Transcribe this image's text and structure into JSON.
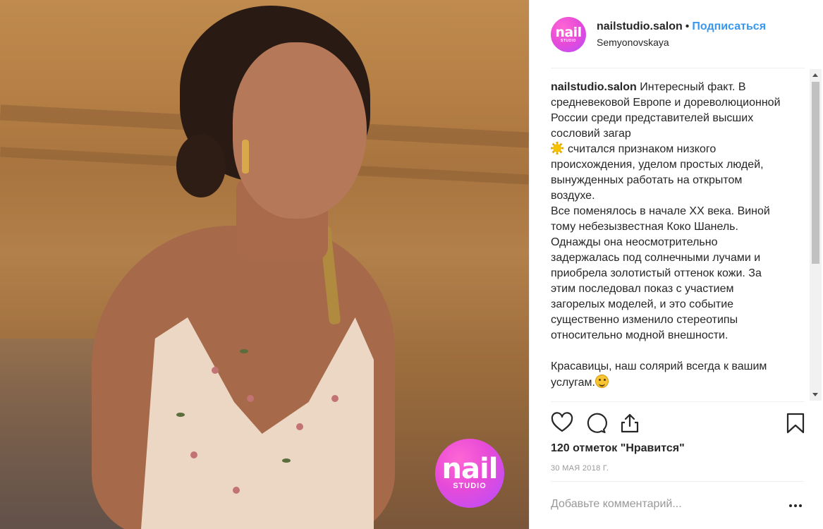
{
  "photo": {
    "logo_word": "nail",
    "logo_sub": "STUDIO"
  },
  "header": {
    "avatar_word": "nail",
    "avatar_sub": "STUDIO",
    "username": "nailstudio.salon",
    "separator": "•",
    "follow_label": "Подписаться",
    "location": "Semyonovskaya"
  },
  "caption": {
    "username": "nailstudio.salon",
    "line1": "Интересный факт. В средневековой Европе и дореволюционной России среди представителей высших сословий загар",
    "line2": "считался признаком низкого происхождения, уделом простых людей, вынужденных работать на открытом воздухе.",
    "line3": "Все поменялось в начале XX века. Виной тому небезызвестная Коко Шанель. Однажды она неосмотрительно задержалась под солнечными лучами и приобрела золотистый оттенок кожи. За этим последовал показ с участием загорелых моделей, и это событие существенно изменило стереотипы относительно модной внешности.",
    "line4": "Красавицы, наш солярий всегда к вашим услугам."
  },
  "actions": {
    "like_icon": "heart-icon",
    "comment_icon": "comment-icon",
    "share_icon": "share-icon",
    "save_icon": "bookmark-icon"
  },
  "likes_text": "120 отметок \"Нравится\"",
  "date_text": "30 МАЯ 2018 Г.",
  "comment": {
    "placeholder": "Добавьте комментарий..."
  },
  "colors": {
    "follow": "#3897f0",
    "brand_gradient_start": "#ff66d4",
    "brand_gradient_end": "#b44dff"
  }
}
